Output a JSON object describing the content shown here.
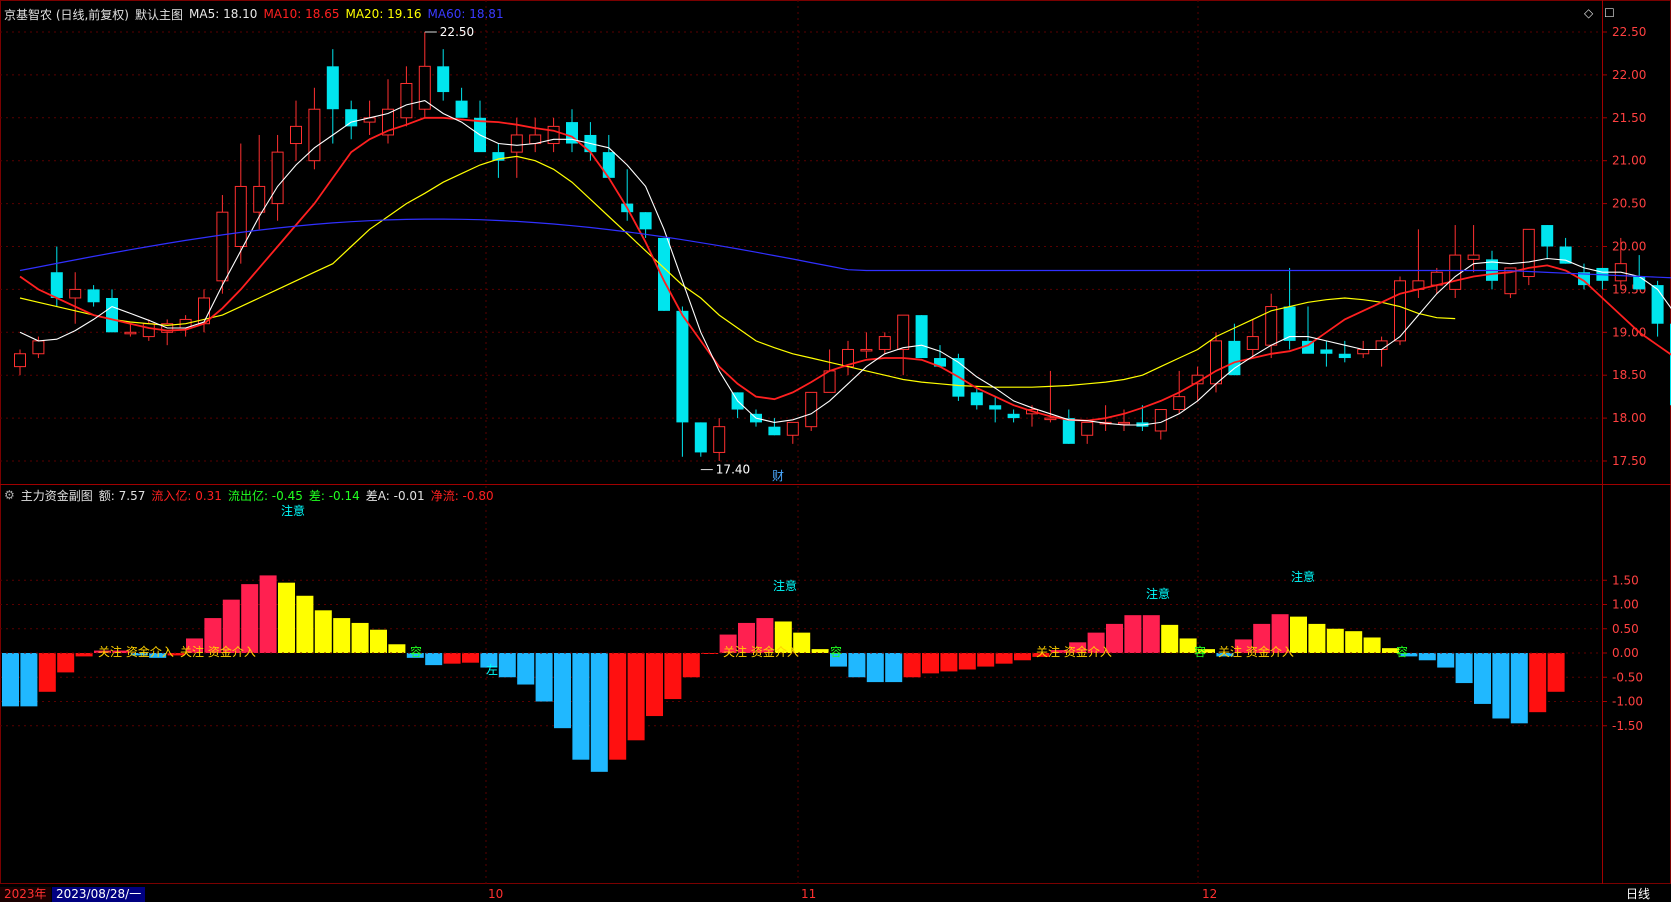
{
  "main_header": {
    "title": "京基智农 (日线,前复权)",
    "chart_name": "默认主图",
    "ma5": "MA5: 18.10",
    "ma10": "MA10: 18.65",
    "ma20": "MA20: 19.16",
    "ma60": "MA60: 18.81",
    "ma5_color": "#ffffff",
    "ma10_color": "#ff2020",
    "ma20_color": "#ffff00",
    "ma60_color": "#3030ff"
  },
  "sub_header": {
    "title": "主力资金副图",
    "amount": "额: 7.57",
    "inflow": "流入亿: 0.31",
    "outflow": "流出亿: -0.45",
    "diff": "差: -0.14",
    "diff_a": "差A: -0.01",
    "net": "净流: -0.80"
  },
  "bottom_bar": {
    "year": "2023年",
    "date": "2023/08/28/一",
    "m10": "10",
    "m11": "11",
    "m12": "12",
    "period": "日线"
  },
  "price_annotations": {
    "high": "22.50",
    "low": "17.40",
    "cai": "财"
  },
  "price_axis": [
    "22.50",
    "22.00",
    "21.50",
    "21.00",
    "20.50",
    "20.00",
    "19.50",
    "19.00",
    "18.50",
    "18.00",
    "17.50"
  ],
  "sub_axis": [
    "1.50",
    "1.00",
    "0.50",
    "0.00",
    "-0.50",
    "-1.00",
    "-1.50"
  ],
  "sub_labels": {
    "attention": "注意",
    "focus_in": "关注 资金介入",
    "left": "左",
    "watch": "容"
  },
  "chart_data": [
    {
      "type": "candlestick",
      "title": "京基智农",
      "ylim": [
        17.25,
        22.65
      ],
      "ohlc": [
        [
          18.6,
          18.8,
          18.5,
          18.75
        ],
        [
          18.75,
          18.95,
          18.7,
          18.9
        ],
        [
          19.7,
          20.0,
          19.3,
          19.4
        ],
        [
          19.4,
          19.7,
          19.1,
          19.5
        ],
        [
          19.5,
          19.55,
          19.3,
          19.35
        ],
        [
          19.4,
          19.5,
          19.0,
          19.0
        ],
        [
          19.0,
          19.1,
          18.95,
          19.0
        ],
        [
          18.95,
          19.15,
          18.9,
          19.1
        ],
        [
          19.0,
          19.15,
          18.85,
          19.1
        ],
        [
          19.05,
          19.2,
          18.95,
          19.15
        ],
        [
          19.1,
          19.5,
          19.0,
          19.4
        ],
        [
          19.6,
          20.6,
          19.45,
          20.4
        ],
        [
          20.0,
          21.2,
          19.8,
          20.7
        ],
        [
          20.4,
          21.3,
          20.2,
          20.7
        ],
        [
          20.5,
          21.3,
          20.3,
          21.1
        ],
        [
          21.2,
          21.7,
          21.0,
          21.4
        ],
        [
          21.0,
          21.85,
          20.9,
          21.6
        ],
        [
          22.1,
          22.3,
          21.2,
          21.6
        ],
        [
          21.6,
          21.7,
          21.25,
          21.4
        ],
        [
          21.45,
          21.7,
          21.3,
          21.5
        ],
        [
          21.3,
          21.95,
          21.2,
          21.6
        ],
        [
          21.5,
          22.1,
          21.4,
          21.9
        ],
        [
          21.6,
          22.5,
          21.5,
          22.1
        ],
        [
          22.1,
          22.3,
          21.7,
          21.8
        ],
        [
          21.7,
          21.85,
          21.6,
          21.5
        ],
        [
          21.5,
          21.7,
          21.45,
          21.1
        ],
        [
          21.1,
          21.2,
          20.8,
          21.0
        ],
        [
          21.1,
          21.5,
          20.8,
          21.3
        ],
        [
          21.2,
          21.5,
          21.1,
          21.3
        ],
        [
          21.2,
          21.5,
          21.1,
          21.4
        ],
        [
          21.45,
          21.6,
          21.1,
          21.2
        ],
        [
          21.3,
          21.45,
          21.0,
          21.1
        ],
        [
          21.1,
          21.3,
          20.8,
          20.8
        ],
        [
          20.5,
          20.9,
          20.3,
          20.4
        ],
        [
          20.4,
          20.4,
          20.1,
          20.2
        ],
        [
          20.1,
          20.1,
          19.25,
          19.25
        ],
        [
          19.25,
          19.3,
          17.55,
          17.95
        ],
        [
          17.95,
          17.95,
          17.55,
          17.6
        ],
        [
          17.6,
          18.0,
          17.5,
          17.9
        ],
        [
          18.3,
          18.3,
          18.0,
          18.1
        ],
        [
          18.05,
          18.1,
          17.9,
          17.95
        ],
        [
          17.9,
          18.0,
          17.8,
          17.8
        ],
        [
          17.8,
          17.95,
          17.7,
          17.95
        ],
        [
          17.9,
          18.3,
          17.85,
          18.3
        ],
        [
          18.3,
          18.8,
          18.3,
          18.55
        ],
        [
          18.6,
          18.9,
          18.5,
          18.8
        ],
        [
          18.8,
          19.0,
          18.7,
          18.8
        ],
        [
          18.8,
          19.0,
          18.75,
          18.95
        ],
        [
          18.8,
          19.2,
          18.5,
          19.2
        ],
        [
          19.2,
          19.2,
          18.7,
          18.7
        ],
        [
          18.7,
          18.85,
          18.6,
          18.6
        ],
        [
          18.7,
          18.75,
          18.2,
          18.25
        ],
        [
          18.3,
          18.35,
          18.1,
          18.15
        ],
        [
          18.15,
          18.25,
          17.95,
          18.1
        ],
        [
          18.05,
          18.1,
          17.95,
          18.0
        ],
        [
          18.05,
          18.15,
          17.9,
          18.1
        ],
        [
          18.0,
          18.55,
          17.95,
          18.0
        ],
        [
          18.0,
          18.1,
          17.7,
          17.7
        ],
        [
          17.8,
          17.95,
          17.7,
          17.95
        ],
        [
          17.95,
          18.15,
          17.85,
          17.95
        ],
        [
          17.95,
          18.1,
          17.85,
          17.95
        ],
        [
          17.95,
          18.15,
          17.85,
          17.9
        ],
        [
          17.85,
          18.1,
          17.75,
          18.1
        ],
        [
          18.1,
          18.55,
          18.05,
          18.25
        ],
        [
          18.4,
          18.6,
          18.2,
          18.5
        ],
        [
          18.4,
          19.0,
          18.3,
          18.9
        ],
        [
          18.9,
          19.1,
          18.5,
          18.5
        ],
        [
          18.8,
          19.15,
          18.7,
          18.95
        ],
        [
          18.85,
          19.45,
          18.7,
          19.3
        ],
        [
          19.3,
          19.75,
          18.8,
          18.9
        ],
        [
          18.9,
          19.3,
          18.8,
          18.75
        ],
        [
          18.8,
          18.9,
          18.6,
          18.75
        ],
        [
          18.75,
          18.9,
          18.65,
          18.7
        ],
        [
          18.75,
          18.9,
          18.7,
          18.8
        ],
        [
          18.8,
          18.95,
          18.6,
          18.9
        ],
        [
          18.9,
          19.65,
          18.85,
          19.6
        ],
        [
          19.5,
          20.2,
          19.4,
          19.6
        ],
        [
          19.55,
          19.75,
          19.45,
          19.7
        ],
        [
          19.5,
          20.25,
          19.4,
          19.9
        ],
        [
          19.85,
          20.25,
          19.7,
          19.9
        ],
        [
          19.85,
          19.95,
          19.5,
          19.6
        ],
        [
          19.45,
          19.7,
          19.4,
          19.75
        ],
        [
          19.65,
          20.0,
          19.55,
          20.2
        ],
        [
          20.25,
          20.25,
          19.85,
          20.0
        ],
        [
          20.0,
          20.1,
          19.8,
          19.8
        ],
        [
          19.7,
          19.8,
          19.5,
          19.55
        ],
        [
          19.75,
          19.75,
          19.5,
          19.6
        ],
        [
          19.6,
          20.1,
          19.5,
          19.8
        ],
        [
          19.65,
          19.9,
          19.55,
          19.5
        ],
        [
          19.55,
          19.6,
          18.95,
          19.1
        ],
        [
          19.1,
          19.1,
          17.85,
          18.15
        ],
        [
          18.0,
          18.1,
          17.95,
          18.0
        ],
        [
          17.9,
          18.0,
          17.75,
          17.9
        ],
        [
          17.85,
          17.9,
          17.6,
          17.8
        ],
        [
          17.8,
          18.6,
          17.8,
          18.5
        ],
        [
          18.5,
          18.6,
          18.2,
          18.35
        ]
      ],
      "ma5": [
        19.0,
        18.9,
        18.92,
        19.02,
        19.15,
        19.3,
        19.22,
        19.14,
        19.05,
        19.05,
        19.12,
        19.55,
        19.95,
        20.35,
        20.7,
        20.95,
        21.15,
        21.3,
        21.45,
        21.5,
        21.55,
        21.65,
        21.7,
        21.55,
        21.45,
        21.3,
        21.2,
        21.18,
        21.2,
        21.25,
        21.25,
        21.2,
        21.15,
        20.95,
        20.7,
        20.2,
        19.6,
        19.0,
        18.55,
        18.2,
        18.0,
        17.95,
        17.98,
        18.05,
        18.2,
        18.4,
        18.6,
        18.75,
        18.82,
        18.85,
        18.78,
        18.65,
        18.48,
        18.35,
        18.2,
        18.12,
        18.05,
        17.98,
        17.97,
        17.94,
        17.92,
        17.92,
        17.95,
        18.05,
        18.2,
        18.4,
        18.58,
        18.72,
        18.85,
        18.95,
        18.95,
        18.9,
        18.85,
        18.8,
        18.8,
        18.95,
        19.2,
        19.45,
        19.65,
        19.8,
        19.82,
        19.8,
        19.82,
        19.86,
        19.84,
        19.75,
        19.7,
        19.7,
        19.65,
        19.5,
        19.2,
        18.8,
        18.45,
        18.1,
        18.1,
        18.15
      ],
      "ma10": [
        19.65,
        19.5,
        19.4,
        19.3,
        19.2,
        19.15,
        19.1,
        19.05,
        19.02,
        19.03,
        19.1,
        19.28,
        19.5,
        19.75,
        20.0,
        20.25,
        20.5,
        20.8,
        21.1,
        21.25,
        21.35,
        21.42,
        21.5,
        21.5,
        21.48,
        21.46,
        21.45,
        21.42,
        21.38,
        21.35,
        21.28,
        21.1,
        20.8,
        20.45,
        20.05,
        19.6,
        19.2,
        18.9,
        18.6,
        18.4,
        18.25,
        18.22,
        18.3,
        18.42,
        18.55,
        18.62,
        18.68,
        18.7,
        18.7,
        18.68,
        18.6,
        18.48,
        18.35,
        18.25,
        18.15,
        18.08,
        18.02,
        17.98,
        17.97,
        18.0,
        18.05,
        18.12,
        18.2,
        18.3,
        18.42,
        18.55,
        18.65,
        18.7,
        18.75,
        18.78,
        18.85,
        19.0,
        19.15,
        19.25,
        19.35,
        19.45,
        19.5,
        19.55,
        19.6,
        19.65,
        19.68,
        19.7,
        19.75,
        19.78,
        19.72,
        19.6,
        19.4,
        19.2,
        19.0,
        18.85,
        18.7,
        18.6
      ],
      "ma20": [
        19.4,
        19.35,
        19.3,
        19.25,
        19.2,
        19.15,
        19.12,
        19.1,
        19.08,
        19.1,
        19.15,
        19.2,
        19.3,
        19.4,
        19.5,
        19.6,
        19.7,
        19.8,
        20.0,
        20.2,
        20.35,
        20.5,
        20.62,
        20.75,
        20.85,
        20.95,
        21.02,
        21.05,
        21.0,
        20.9,
        20.75,
        20.55,
        20.35,
        20.15,
        19.95,
        19.75,
        19.55,
        19.4,
        19.2,
        19.05,
        18.9,
        18.82,
        18.75,
        18.7,
        18.65,
        18.6,
        18.55,
        18.5,
        18.45,
        18.42,
        18.4,
        18.38,
        18.37,
        18.36,
        18.36,
        18.36,
        18.37,
        18.38,
        18.4,
        18.42,
        18.45,
        18.5,
        18.6,
        18.7,
        18.8,
        18.95,
        19.05,
        19.15,
        19.25,
        19.3,
        19.35,
        19.38,
        19.4,
        19.38,
        19.35,
        19.3,
        19.22,
        19.17,
        19.16
      ]
    },
    {
      "type": "bar",
      "title": "主力资金副图",
      "ylim": [
        -2.6,
        1.75
      ],
      "values": [
        -1.1,
        -1.1,
        -0.8,
        -0.4,
        -0.07,
        0.05,
        0.05,
        -0.05,
        -0.1,
        -0.05,
        0.3,
        0.72,
        1.1,
        1.42,
        1.6,
        1.45,
        1.18,
        0.88,
        0.72,
        0.62,
        0.48,
        0.18,
        -0.1,
        -0.25,
        -0.22,
        -0.2,
        -0.3,
        -0.5,
        -0.65,
        -1.0,
        -1.55,
        -2.2,
        -2.45,
        -2.2,
        -1.8,
        -1.3,
        -0.95,
        -0.5,
        -0.02,
        0.38,
        0.62,
        0.72,
        0.65,
        0.42,
        0.08,
        -0.28,
        -0.5,
        -0.6,
        -0.6,
        -0.5,
        -0.42,
        -0.38,
        -0.34,
        -0.28,
        -0.22,
        -0.15,
        -0.08,
        0.06,
        0.22,
        0.42,
        0.6,
        0.78,
        0.78,
        0.58,
        0.3,
        0.08,
        -0.07,
        0.28,
        0.6,
        0.8,
        0.75,
        0.6,
        0.5,
        0.45,
        0.32,
        0.1,
        -0.07,
        -0.15,
        -0.3,
        -0.62,
        -1.05,
        -1.35,
        -1.45,
        -1.22,
        -0.8
      ]
    }
  ]
}
